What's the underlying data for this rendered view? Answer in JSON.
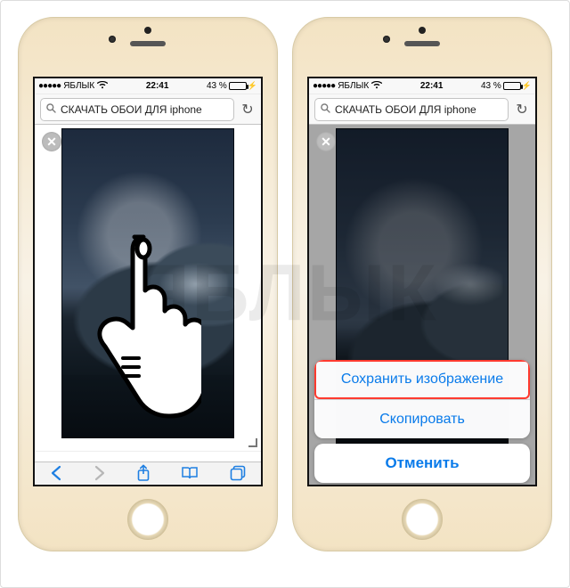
{
  "status": {
    "carrier": "ЯБЛЫК",
    "time": "22:41",
    "battery_text": "43 %",
    "battery_fill_pct": 43
  },
  "search": {
    "query": "СКАЧАТЬ ОБОИ ДЛЯ iphone"
  },
  "actionsheet": {
    "save_image": "Сохранить изображение",
    "copy": "Скопировать",
    "cancel": "Отменить"
  },
  "watermark": "ЯБЛЫК"
}
